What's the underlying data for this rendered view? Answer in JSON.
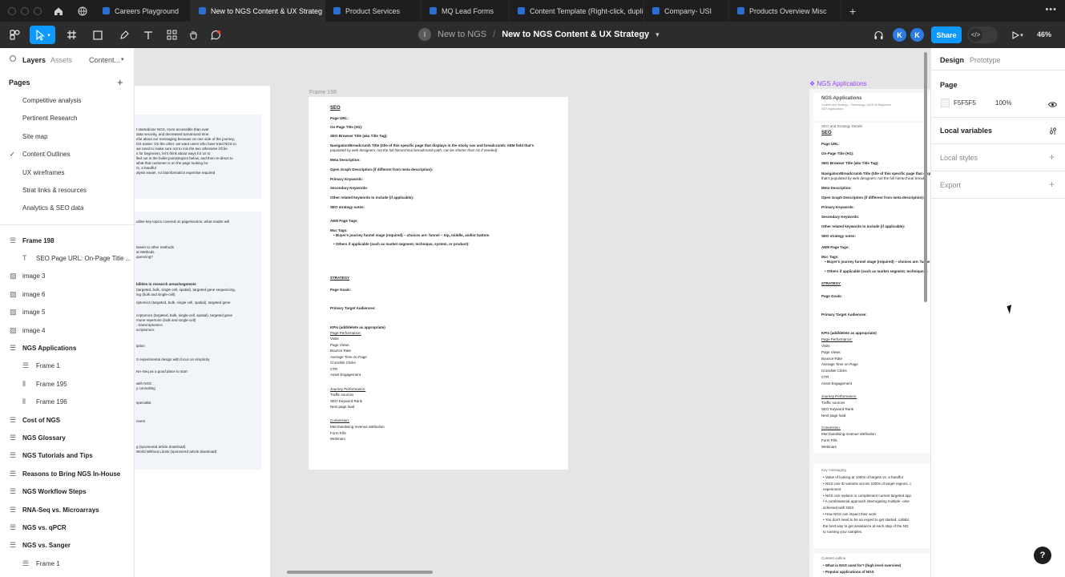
{
  "tabs": [
    {
      "label": "Careers Playground",
      "active": false
    },
    {
      "label": "New to NGS Content & UX Strateg",
      "active": true
    },
    {
      "label": "Product Services",
      "active": false
    },
    {
      "label": "MQ Lead Forms",
      "active": false
    },
    {
      "label": "Content Template (Right-click, dupli",
      "active": false
    },
    {
      "label": "Company- USI",
      "active": false
    },
    {
      "label": "Products Overview Misc",
      "active": false
    }
  ],
  "toolbar": {
    "project": "New to NGS",
    "separator": "/",
    "file_name": "New to NGS Content & UX Strategy",
    "project_badge": "I",
    "avatar_1": "K",
    "avatar_2": "K",
    "share_label": "Share",
    "zoom": "46%",
    "icons": [
      "figma-menu-icon",
      "move-tool-icon",
      "frame-tool-icon",
      "shape-tool-icon",
      "pen-tool-icon",
      "text-tool-icon",
      "components-icon",
      "hand-tool-icon",
      "comment-icon"
    ]
  },
  "left_panel": {
    "tab_layers": "Layers",
    "tab_assets": "Assets",
    "tab_content": "Content...",
    "pages_heading": "Pages",
    "pages": [
      {
        "label": "Competitive analysis",
        "current": false
      },
      {
        "label": "Pertinent Research",
        "current": false
      },
      {
        "label": "Site map",
        "current": false
      },
      {
        "label": "Content Outlines",
        "current": true
      },
      {
        "label": "UX wireframes",
        "current": false
      },
      {
        "label": "Strat links & resources",
        "current": false
      },
      {
        "label": "Analytics & SEO data",
        "current": false
      }
    ],
    "layers": [
      {
        "label": "Frame 198",
        "bold": true,
        "indent": 0,
        "icon": "section"
      },
      {
        "label": "SEO Page URL: On-Page Title ...",
        "bold": false,
        "indent": 1,
        "icon": "text"
      },
      {
        "label": "image 3",
        "bold": false,
        "indent": 0,
        "icon": "image"
      },
      {
        "label": "image 6",
        "bold": false,
        "indent": 0,
        "icon": "image"
      },
      {
        "label": "image 5",
        "bold": false,
        "indent": 0,
        "icon": "image"
      },
      {
        "label": "image 4",
        "bold": false,
        "indent": 0,
        "icon": "image"
      },
      {
        "label": "NGS Applications",
        "bold": true,
        "indent": 0,
        "icon": "section"
      },
      {
        "label": "Frame 1",
        "bold": false,
        "indent": 1,
        "icon": "rows"
      },
      {
        "label": "Frame 195",
        "bold": false,
        "indent": 1,
        "icon": "cols"
      },
      {
        "label": "Frame 196",
        "bold": false,
        "indent": 1,
        "icon": "cols"
      },
      {
        "label": "Cost of NGS",
        "bold": true,
        "indent": 0,
        "icon": "section"
      },
      {
        "label": "NGS Glossary",
        "bold": true,
        "indent": 0,
        "icon": "section"
      },
      {
        "label": "NGS Tutorials and Tips",
        "bold": true,
        "indent": 0,
        "icon": "section"
      },
      {
        "label": "Reasons to Bring NGS In-House",
        "bold": true,
        "indent": 0,
        "icon": "section"
      },
      {
        "label": "NGS Workflow Steps",
        "bold": true,
        "indent": 0,
        "icon": "section"
      },
      {
        "label": "RNA-Seq vs. Microarrays",
        "bold": true,
        "indent": 0,
        "icon": "section"
      },
      {
        "label": "NGS vs. qPCR",
        "bold": true,
        "indent": 0,
        "icon": "section"
      },
      {
        "label": "NGS vs. Sanger",
        "bold": true,
        "indent": 0,
        "icon": "section"
      },
      {
        "label": "Frame 1",
        "bold": false,
        "indent": 1,
        "icon": "rows"
      }
    ]
  },
  "canvas": {
    "left_frame_lines": [
      "t started/use NGS, more accessible than ever",
      "data security, and decreased turnaround time.",
      "eful about our messaging because on one side of the journey,",
      "GS easier. On the other, we want users who have tried NGS to",
      "we need to make sure not to mix the two otherwise it'll be",
      "s for beginners, let's think about ways for us to",
      "lled out in the bullet points/topics below, and then re-direct to",
      "what that customer is on the page looking for.",
      "rs, a handful",
      "alysis easier, no bioinformatics expertise required",
      "utline key topics covered on page/section, what reader will",
      "tween to other methods",
      "ar Methods",
      "quencing?",
      "bilities in research areas/segments",
      "(targeted, bulk, single cell, spatial), targeted gene sequencing,",
      "ing (bulk and single-cell)",
      "riptomics (targeted, bulk, single cell, spatial), targeted gene",
      "criptomics (targeted, bulk, single-cell, spatial), targeted gene",
      "mune repertoire (bulk and single-cell)",
      ", transcriptomics",
      "scriptomics",
      "iption",
      "S experimental design with focus on simplicity",
      "NA-Seq as a good place to start",
      "with NGS",
      "y consulting",
      "specialist",
      "nners",
      "g (sponsored article download)",
      "World Without Limits (sponsored article download)"
    ],
    "frame198_label": "Frame 198",
    "frame198": {
      "seo_heading": "SEO",
      "lines": [
        {
          "t": "Page URL:",
          "b": true
        },
        {
          "t": "On-Page Title (H1):",
          "b": true
        },
        {
          "t": "SEO Browser Title (aka Title Tag):",
          "b": true
        },
        {
          "t": "Navigation/Breadcrumb Title (title of this specific page that displays in the sticky nav and breadcrumb; AEM field that's",
          "b": true
        },
        {
          "t": "populated by web designers; not the full hierarchical breadcrumb path, can be shorter than H1 if needed):",
          "b": false
        },
        {
          "t": "Meta Description:",
          "b": true
        },
        {
          "t": "Open Graph Description (if different from meta description):",
          "b": true
        },
        {
          "t": "Primary Keywords:",
          "b": true
        },
        {
          "t": "Secondary Keywords:",
          "b": true
        },
        {
          "t": "Other related keywords to include (if applicable):",
          "b": true
        },
        {
          "t": "SEO strategy notes:",
          "b": true
        },
        {
          "t": "AEM Page Tags:",
          "b": true
        },
        {
          "t": "Mcc Tags:",
          "b": true
        },
        {
          "t": "• Buyer's journey funnel stage (required) – choices are: funnel – top, middle, and/or bottom",
          "b": true
        },
        {
          "t": "• Others if applicable (such as market segment, technique, system, or product):",
          "b": true
        }
      ],
      "strategy_heading": "STRATEGY",
      "page_goals": "Page Goals:",
      "audiences": "Primary Target Audiences:",
      "kpis": "KPIs (add/delete as appropriate)",
      "page_perf": "Page Performance:",
      "perf_items": [
        "Visits",
        "Page Views",
        "Bounce Rate",
        "Average Time on Page",
        "Crosslink Clicks",
        "CTR",
        "Asset Engagement"
      ],
      "journey": "Journey Performance:",
      "journey_items": [
        "Traffic sources",
        "SEO Keyword Rank",
        "Next page load"
      ],
      "conversion": "Conversion:",
      "conversion_items": [
        "Merchandising revenue attribution",
        "Form Fills",
        "Webinars"
      ]
    },
    "ngs_label": "NGS Applications",
    "ngs_frame": {
      "title": "NGS Applications",
      "sub1": "Content and Strategy – Technology | NGS for Beginners",
      "sub2": "NGS Applications",
      "seo_details": "SEO and Strategy Details",
      "seo_heading": "SEO",
      "lines": [
        {
          "t": "Page URL:",
          "b": true
        },
        {
          "t": "On-Page Title (H1):",
          "b": true
        },
        {
          "t": "SEO Browser Title (aka Title Tag):",
          "b": true
        },
        {
          "t": "Navigation/Breadcrumb Title (title of this specific page that displays in the sticky",
          "b": true
        },
        {
          "t": "that's populated by web designers; not the full hierarchical bread",
          "b": false
        },
        {
          "t": "Meta Description:",
          "b": true
        },
        {
          "t": "Open Graph Description (if different from meta description):",
          "b": true
        },
        {
          "t": "Primary Keywords:",
          "b": true
        },
        {
          "t": "Secondary Keywords:",
          "b": true
        },
        {
          "t": "Other related keywords to include (if applicable):",
          "b": true
        },
        {
          "t": "SEO strategy notes:",
          "b": true
        },
        {
          "t": "AEM Page Tags:",
          "b": true
        },
        {
          "t": "Mcc Tags:",
          "b": true
        },
        {
          "t": "• Buyer's journey funnel stage (required) – choices are: funne",
          "b": true
        },
        {
          "t": "• Others if applicable (such as market segment, technique, s",
          "b": true
        }
      ],
      "strategy_heading": "STRATEGY",
      "page_goals": "Page Goals:",
      "audiences": "Primary Target Audiences:",
      "kpis": "KPIs (add/delete as appropriate)",
      "page_perf": "Page Performance:",
      "perf_items": [
        "Visits",
        "Page Views",
        "Bounce Rate",
        "Average Time on Page",
        "Crosslink Clicks",
        "CTR",
        "Asset Engagement"
      ],
      "journey": "Journey Performance:",
      "journey_items": [
        "Traffic sources",
        "SEO Keyword Rank",
        "Next page load"
      ],
      "conversion": "Conversion:",
      "conversion_items": [
        "Merchandising revenue attribution",
        "Form Fills",
        "Webinars"
      ],
      "key_messaging": "Key messaging",
      "km_items": [
        "• Value of looking at 1000s of targets vs. a handful",
        "• NGS can ID variants across 1000s of target regions, c",
        "   experiment",
        "• NGS can replace or complement current targeted app",
        "• A combinatorial approach interrogating multiple -ome",
        "   achieved with NGS",
        "• How NGS can impact their work",
        "• You don't need to be an expert to get started: collabc",
        "   the best way to get assistance at each step of the NG",
        "   to running your samples."
      ],
      "content_outline": "Content outline",
      "co_items": [
        "• What is NGS used for? (high level overview)",
        "• Popular applications of NGS"
      ]
    }
  },
  "right_panel": {
    "tab_design": "Design",
    "tab_prototype": "Prototype",
    "page_heading": "Page",
    "page_color": "F5F5F5",
    "page_opacity": "100%",
    "local_variables": "Local variables",
    "local_styles": "Local styles",
    "export": "Export"
  },
  "help_label": "?"
}
